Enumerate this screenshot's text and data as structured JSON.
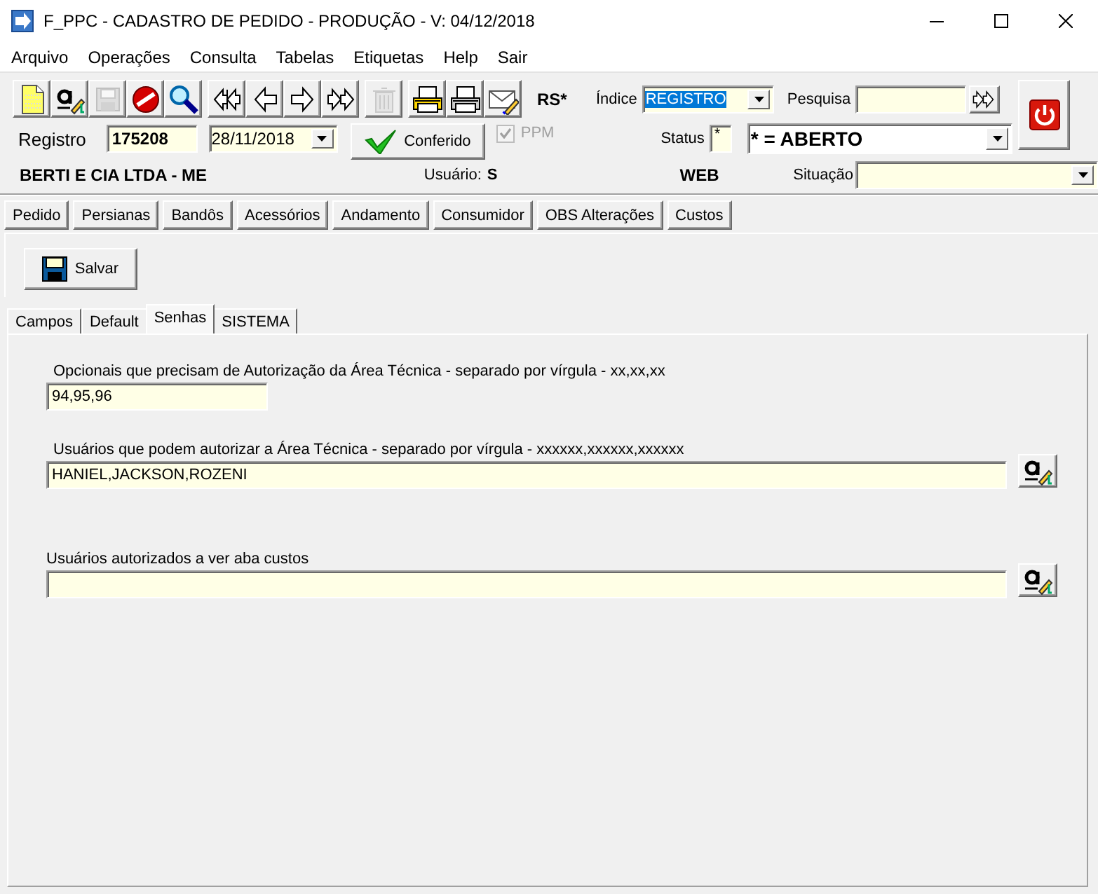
{
  "window": {
    "title": "F_PPC - CADASTRO DE PEDIDO - PRODUÇÃO - V: 04/12/2018"
  },
  "menu": [
    "Arquivo",
    "Operações",
    "Consulta",
    "Tabelas",
    "Etiquetas",
    "Help",
    "Sair"
  ],
  "toolbar": [
    {
      "kind": "new",
      "disabled": false
    },
    {
      "kind": "spell",
      "disabled": false
    },
    {
      "kind": "save",
      "disabled": true
    },
    {
      "kind": "cancel",
      "disabled": false
    },
    {
      "kind": "search",
      "disabled": false
    },
    {
      "kind": "first",
      "disabled": false
    },
    {
      "kind": "prev",
      "disabled": false
    },
    {
      "kind": "next",
      "disabled": false
    },
    {
      "kind": "last",
      "disabled": false
    },
    {
      "kind": "delete",
      "disabled": true
    },
    {
      "kind": "print",
      "disabled": false
    },
    {
      "kind": "printer",
      "disabled": false
    },
    {
      "kind": "email",
      "disabled": false
    }
  ],
  "header": {
    "rs": "RS*",
    "indice": {
      "label": "Índice",
      "value": "REGISTRO",
      "value_selected": true
    },
    "pesquisa": {
      "label": "Pesquisa"
    },
    "registro": {
      "label": "Registro",
      "value": "175208"
    },
    "date": "28/11/2018",
    "conferido_button": "Conferido",
    "ppm": {
      "label": "PPM",
      "checked": true,
      "disabled": true
    },
    "status": {
      "label": "Status",
      "code": "*",
      "value": "* = ABERTO"
    },
    "company": "BERTI E CIA LTDA - ME",
    "usuario": {
      "label": "Usuário:",
      "value": "S"
    },
    "web": "WEB",
    "situacao": {
      "label": "Situação"
    }
  },
  "tabs": [
    "Pedido",
    "Persianas",
    "Bandôs",
    "Acessórios",
    "Andamento",
    "Consumidor",
    "OBS Alterações",
    "Custos"
  ],
  "save_button": "Salvar",
  "subtabs": [
    {
      "label": "Campos",
      "selected": false
    },
    {
      "label": "Default",
      "selected": false
    },
    {
      "label": "Senhas",
      "selected": true
    },
    {
      "label": "SISTEMA",
      "selected": false
    }
  ],
  "fields": [
    {
      "kind": "short",
      "label": "Opcionais que precisam de Autorização da Área Técnica - separado por vírgula - xx,xx,xx",
      "value": "94,95,96"
    },
    {
      "kind": "picker",
      "label": "Usuários que podem autorizar a Área Técnica - separado por vírgula - xxxxxx,xxxxxx,xxxxxx",
      "value": "HANIEL,JACKSON,ROZENI"
    },
    {
      "kind": "picker",
      "label": "Usuários autorizados a ver aba custos"
    }
  ]
}
